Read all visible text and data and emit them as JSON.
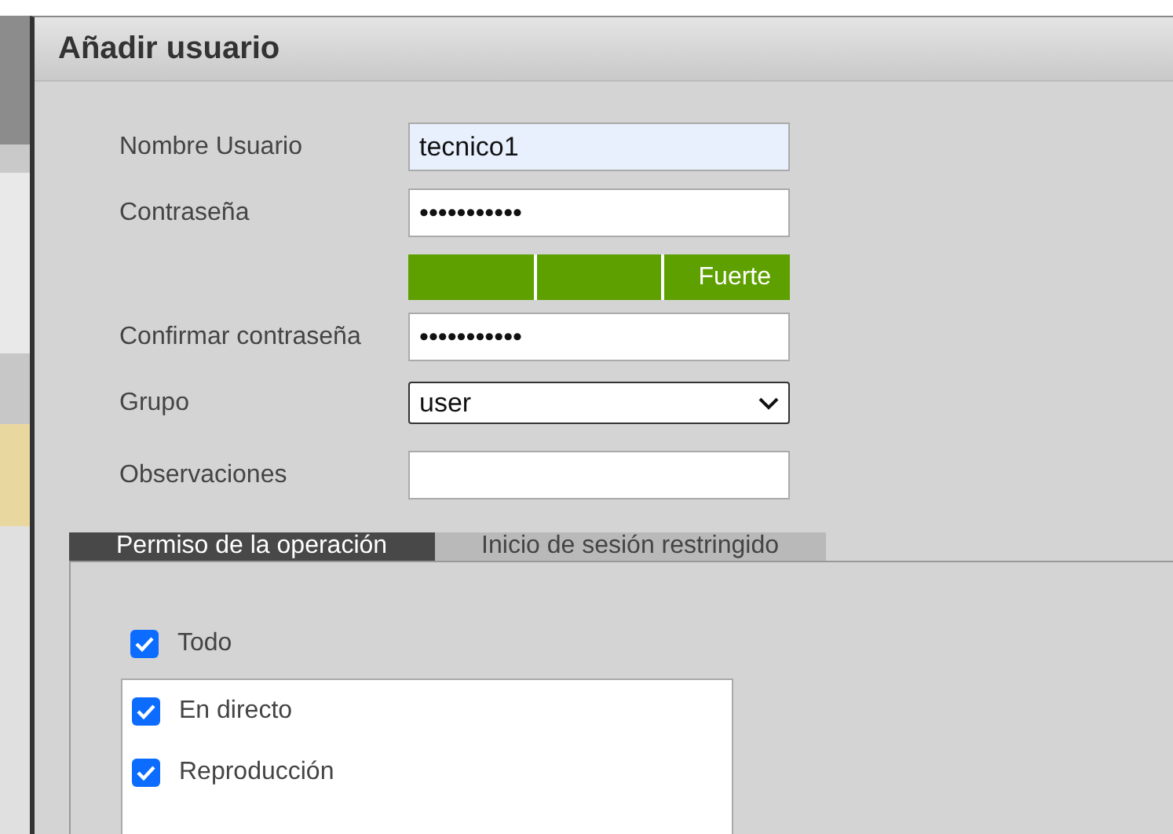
{
  "dialog": {
    "title": "Añadir usuario"
  },
  "form": {
    "fields": [
      {
        "kind": "text",
        "label": "Nombre Usuario",
        "value": "tecnico1",
        "focused": true
      },
      {
        "kind": "password",
        "label": "Contraseña",
        "value": "•••••••••••"
      },
      {
        "kind": "strength",
        "level": 1,
        "reading": "Fuerte"
      },
      {
        "kind": "password",
        "label": "Confirmar contraseña",
        "value": "•••••••••••"
      },
      {
        "kind": "select",
        "label": "Grupo",
        "value": "user"
      },
      {
        "kind": "text",
        "label": "Observaciones"
      }
    ]
  },
  "tabs": [
    {
      "label": "Permiso de la operación",
      "selected": true
    },
    {
      "label": "Inicio de sesión restringido",
      "selected": false
    }
  ],
  "permissions": {
    "all": {
      "label": "Todo",
      "checked": true
    },
    "items": [
      {
        "label": "En directo",
        "checked": true
      },
      {
        "label": "Reproducción",
        "checked": true
      }
    ]
  }
}
